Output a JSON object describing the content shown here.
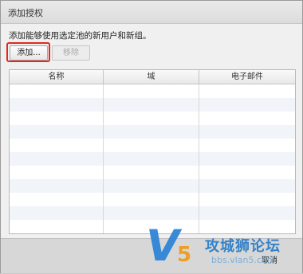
{
  "window": {
    "title": "添加授权"
  },
  "description": "添加能够使用选定池的新用户和新组。",
  "toolbar": {
    "add_label": "添加...",
    "remove_label": "移除"
  },
  "table": {
    "columns": [
      "名称",
      "域",
      "电子邮件"
    ],
    "rows": []
  },
  "footer": {
    "cancel_label": "取消"
  },
  "watermark": {
    "logo_letter": "V",
    "logo_digit": "5",
    "brand": "攻城狮论坛",
    "url": "bbs.vlan5.com"
  },
  "colors": {
    "highlight": "#e02a1e",
    "accent": "#2f84d6"
  }
}
